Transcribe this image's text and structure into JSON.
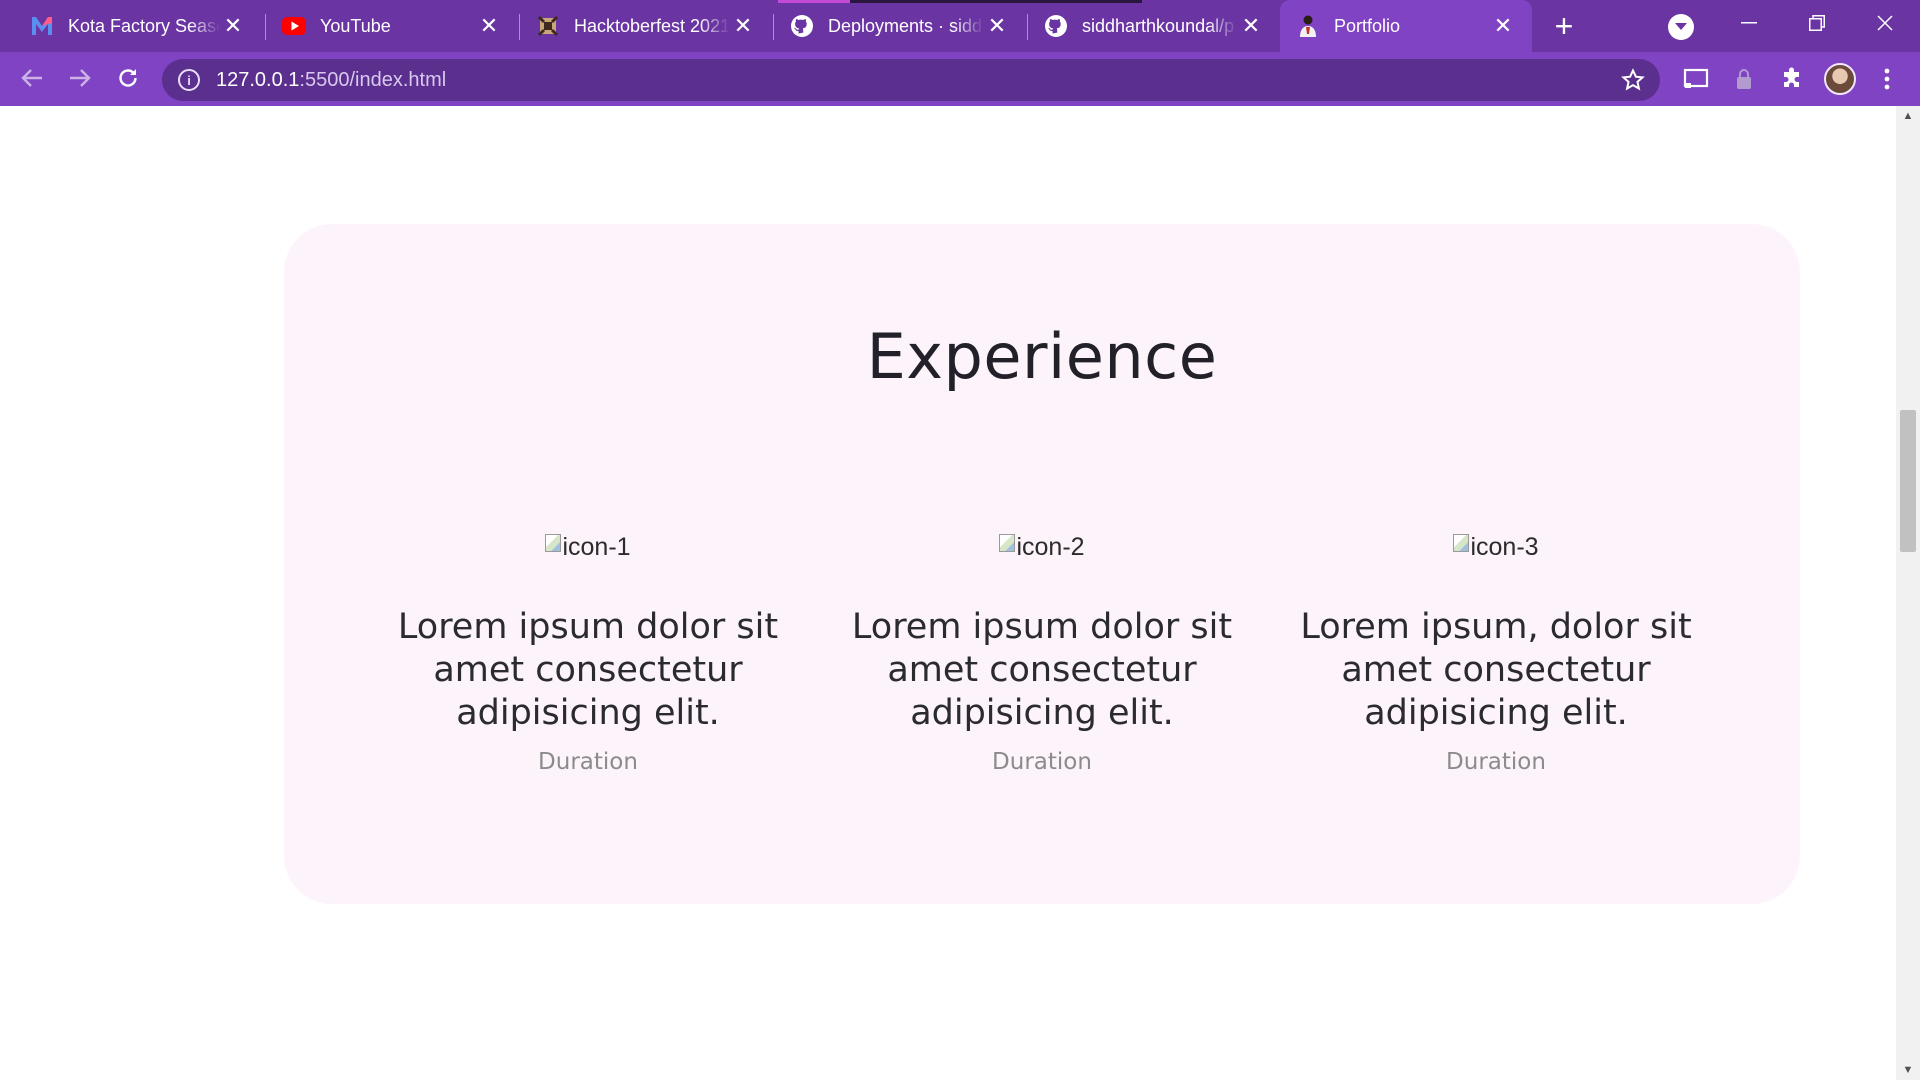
{
  "browser": {
    "tabs": [
      {
        "title": "Kota Factory Season",
        "favicon": "m-logo-icon",
        "active": false
      },
      {
        "title": "YouTube",
        "favicon": "youtube-icon",
        "active": false
      },
      {
        "title": "Hacktoberfest 2021",
        "favicon": "hacktoberfest-icon",
        "active": false
      },
      {
        "title": "Deployments · siddh",
        "favicon": "github-icon",
        "active": false
      },
      {
        "title": "siddharthkoundal/p",
        "favicon": "github-icon",
        "active": false
      },
      {
        "title": "Portfolio",
        "favicon": "portfolio-icon",
        "active": true
      }
    ],
    "address": {
      "host": "127.0.0.1",
      "rest": ":5500/index.html"
    },
    "colors": {
      "frame": "#6a34a2",
      "toolbar": "#8043c4",
      "omnibox": "#5b2f8e"
    }
  },
  "page": {
    "experience": {
      "heading": "Experience",
      "items": [
        {
          "icon_alt": "icon-1",
          "title": "Lorem ipsum dolor sit amet consectetur adipisicing elit.",
          "duration": "Duration"
        },
        {
          "icon_alt": "icon-2",
          "title": "Lorem ipsum dolor sit amet consectetur adipisicing elit.",
          "duration": "Duration"
        },
        {
          "icon_alt": "icon-3",
          "title": "Lorem ipsum, dolor sit amet consectetur adipisicing elit.",
          "duration": "Duration"
        }
      ],
      "colors": {
        "card_background": "#fdf4fb",
        "heading": "#22212a",
        "duration": "#8b8b8b"
      }
    }
  }
}
